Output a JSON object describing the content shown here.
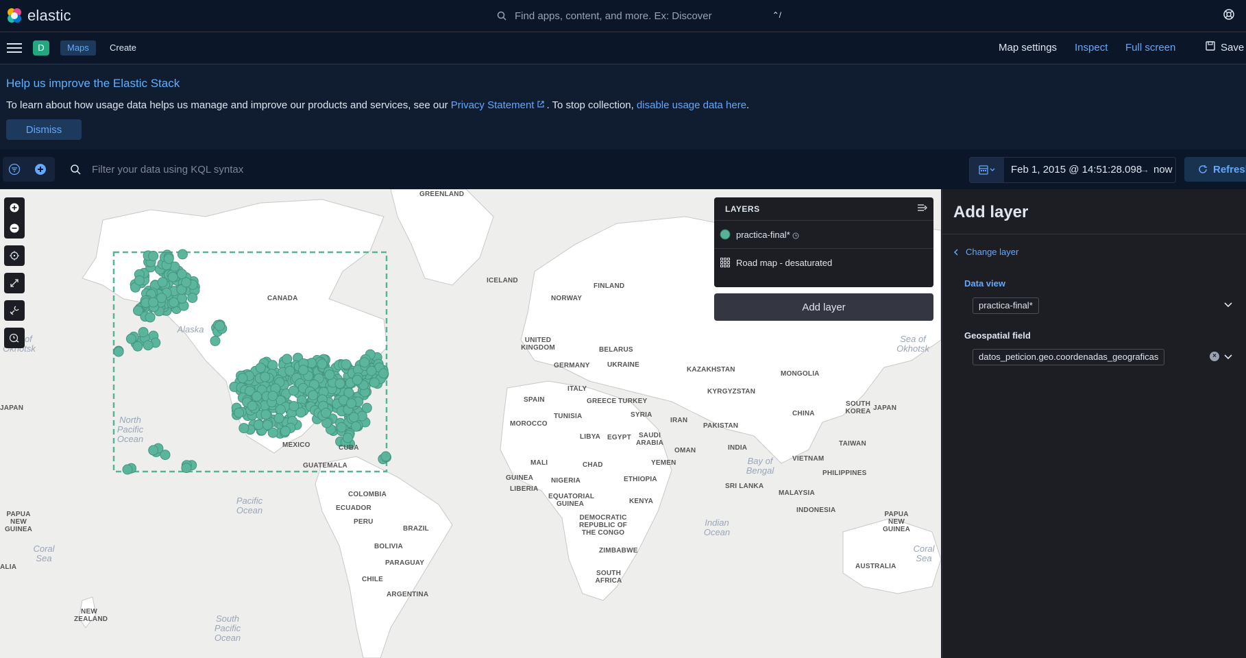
{
  "header": {
    "logo_text": "elastic",
    "search_placeholder": "Find apps, content, and more. Ex: Discover",
    "search_shortcut": "⌃/",
    "help_icon": "help-icon"
  },
  "nav": {
    "avatar_letter": "D",
    "breadcrumbs": [
      "Maps",
      "Create"
    ],
    "map_settings": "Map settings",
    "inspect": "Inspect",
    "full_screen": "Full screen",
    "save": "Save"
  },
  "banner": {
    "title": "Help us improve the Elastic Stack",
    "text_before": "To learn about how usage data helps us manage and improve our products and services, see our ",
    "privacy_link": "Privacy Statement",
    "text_middle": ". To stop collection, ",
    "disable_link": "disable usage data here",
    "text_after": ".",
    "dismiss": "Dismiss"
  },
  "query": {
    "placeholder": "Filter your data using KQL syntax",
    "start_date": "Feb 1, 2015 @ 14:51:28.098",
    "arrow": "→",
    "end_date": "now",
    "refresh": "Refresh"
  },
  "map": {
    "country_labels": [
      "GREENLAND",
      "ICELAND",
      "CANADA",
      "FINLAND",
      "NORWAY",
      "UNITED KINGDOM",
      "BELARUS",
      "GERMANY",
      "UKRAINE",
      "KAZAKHSTAN",
      "MONGOLIA",
      "KYRGYZSTAN",
      "ITALY",
      "SPAIN",
      "GREECE",
      "TURKEY",
      "TUNISIA",
      "SYRIA",
      "IRAN",
      "MOROCCO",
      "LIBYA",
      "EGYPT",
      "SAUDI ARABIA",
      "PAKISTAN",
      "CHINA",
      "SOUTH KOREA",
      "JAPAN",
      "TAIWAN",
      "OMAN",
      "INDIA",
      "MEXICO",
      "CUBA",
      "MALI",
      "CHAD",
      "YEMEN",
      "VIETNAM",
      "PHILIPPINES",
      "GUATEMALA",
      "GUINEA",
      "NIGERIA",
      "ETHIOPIA",
      "SRI LANKA",
      "MALAYSIA",
      "LIBERIA",
      "COLOMBIA",
      "EQUATORIAL GUINEA",
      "KENYA",
      "ECUADOR",
      "INDONESIA",
      "PERU",
      "DEMOCRATIC REPUBLIC OF THE CONGO",
      "PAPUA NEW GUINEA",
      "BRAZIL",
      "BOLIVIA",
      "ZIMBABWE",
      "PARAGUAY",
      "AUSTRALIA",
      "CHILE",
      "SOUTH AFRICA",
      "ARGENTINA",
      "NEW ZEALAND",
      "JAPAN",
      "PAPUA NEW GUINEA",
      "ALIA"
    ],
    "ocean_labels": [
      "North Pacific Ocean",
      "Pacific Ocean",
      "Indian Ocean",
      "South Pacific Ocean",
      "Coral Sea",
      "Coral Sea",
      "Bay of Bengal",
      "Sea of Okhotsk",
      "Sea of Okhotsk",
      "Alaska"
    ],
    "tools": [
      "zoom-in-icon",
      "zoom-out-icon",
      "set-view-icon",
      "fit-to-data-icon",
      "tools-icon",
      "timeslider-icon"
    ]
  },
  "layers": {
    "title": "LAYERS",
    "items": [
      {
        "name": "practica-final*",
        "color": "#54b399"
      },
      {
        "name": "Road map - desaturated"
      }
    ],
    "add_layer": "Add layer"
  },
  "panel": {
    "title": "Add layer",
    "change_layer": "Change layer",
    "data_view_label": "Data view",
    "data_view_value": "practica-final*",
    "geo_field_label": "Geospatial field",
    "geo_field_value": "datos_peticion.geo.coordenadas_geograficas"
  },
  "colors": {
    "accent": "#62a8ff",
    "point": "#54b399",
    "background": "#0b1628",
    "panel": "#1d1e24"
  }
}
